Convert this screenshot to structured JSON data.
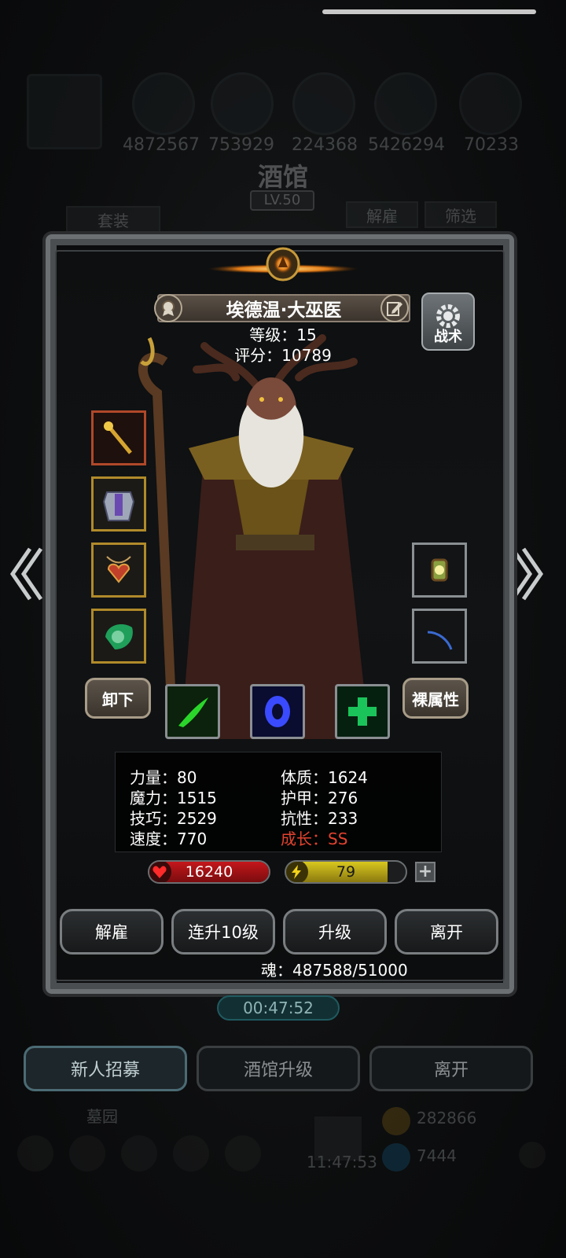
{
  "resources": [
    "4872567",
    "753929",
    "224368",
    "5426294",
    "70233"
  ],
  "tavern": {
    "title": "酒馆",
    "level": "LV.50"
  },
  "top_buttons": {
    "set": "套装",
    "dismiss": "解雇",
    "filter": "筛选"
  },
  "hero": {
    "name": "埃德温·大巫医",
    "level_text": "等级：15",
    "score_text": "评分：10789",
    "tactics_label": "战术"
  },
  "equipment_left": [
    "staff-icon",
    "armor-icon",
    "amulet-icon",
    "ring-icon"
  ],
  "equipment_right": [
    "lantern-icon",
    "blade-icon"
  ],
  "buttons": {
    "unequip": "卸下",
    "base_attr": "裸属性"
  },
  "skills": [
    {
      "name": "green-slash-icon",
      "color": "#2bd62b"
    },
    {
      "name": "blue-spirit-icon",
      "color": "#3a4bff"
    },
    {
      "name": "green-cross-icon",
      "color": "#1bc45a"
    }
  ],
  "stats": {
    "strength": "力量：80",
    "magic": "魔力：1515",
    "skill": "技巧：2529",
    "speed": "速度：770",
    "constitution": "体质：1624",
    "armor": "护甲：276",
    "resistance": "抗性：233",
    "growth": "成长：SS"
  },
  "bars": {
    "hp": "16240",
    "energy": "79",
    "hp_fill": 1.0,
    "energy_fill": 0.85,
    "hp_color": "#c4171b",
    "energy_color": "#d8c71e"
  },
  "actions": {
    "dismiss": "解雇",
    "level10": "连升10级",
    "upgrade": "升级",
    "leave": "离开"
  },
  "soul_text": "魂：487588/51000",
  "timer": "00:47:52",
  "bottom": {
    "recruit": "新人招募",
    "upgrade_tavern": "酒馆升级",
    "leave": "离开"
  },
  "footer": {
    "graveyard": "墓园",
    "coins": "282866",
    "time": "11:47:53",
    "gems": "7444"
  }
}
